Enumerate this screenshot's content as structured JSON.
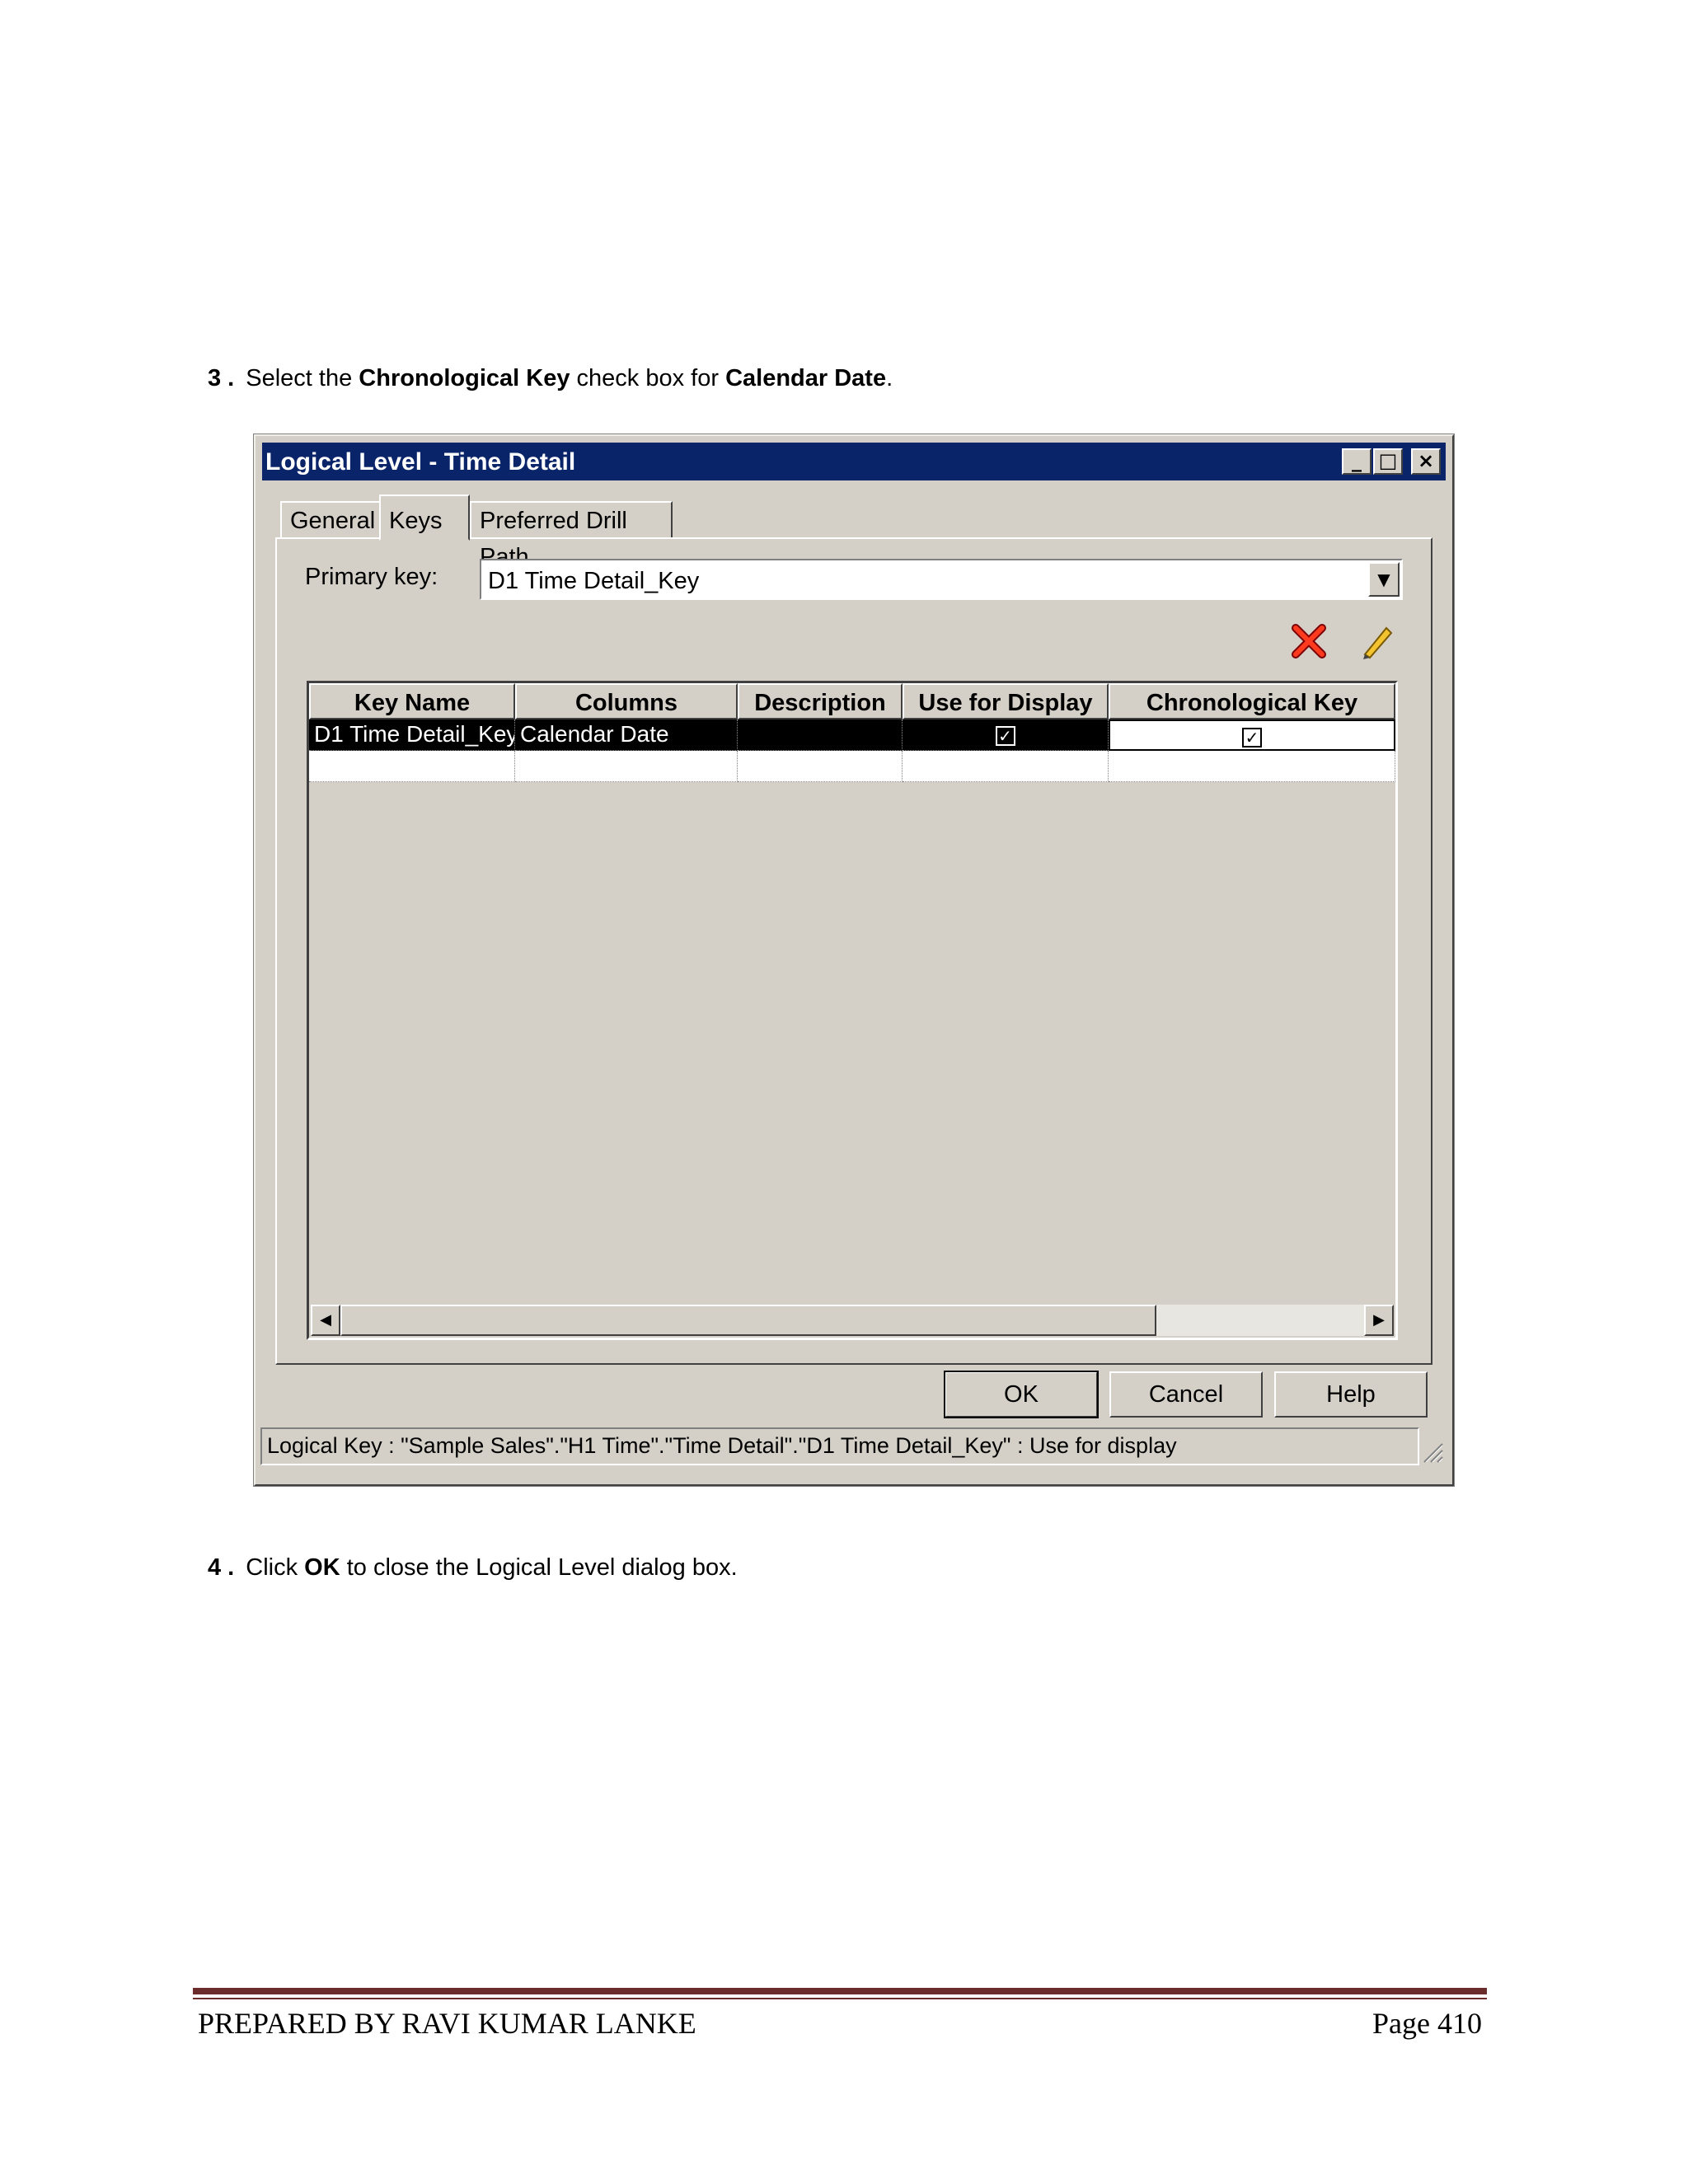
{
  "instructions": {
    "step3": {
      "number": "3 .",
      "pre": "Select the ",
      "b1": "Chronological Key",
      "mid": " check box for ",
      "b2": "Calendar Date",
      "post": "."
    },
    "step4": {
      "number": "4 .",
      "pre": "Click ",
      "b1": "OK",
      "post": " to close the Logical Level dialog box."
    }
  },
  "dialog": {
    "title": "Logical Level - Time Detail",
    "tabs": [
      {
        "label": "General",
        "active": false
      },
      {
        "label": "Keys",
        "active": true
      },
      {
        "label": "Preferred Drill Path",
        "active": false
      }
    ],
    "primary_key_label": "Primary key:",
    "primary_key_value": "D1 Time Detail_Key",
    "toolbar_icons": [
      "delete-icon",
      "edit-icon"
    ],
    "grid": {
      "columns": [
        "Key Name",
        "Columns",
        "Description",
        "Use for Display",
        "Chronological Key"
      ],
      "rows": [
        {
          "key_name": "D1 Time Detail_Key",
          "columns": "Calendar Date",
          "description": "",
          "use_for_display": true,
          "chronological_key": true
        }
      ]
    },
    "buttons": {
      "ok": "OK",
      "cancel": "Cancel",
      "help": "Help"
    },
    "status": "Logical Key : \"Sample Sales\".\"H1 Time\".\"Time Detail\".\"D1 Time Detail_Key\" : Use for display",
    "check_glyph": "✓"
  },
  "footer": {
    "left": "PREPARED BY RAVI KUMAR LANKE",
    "right": "Page 410"
  },
  "colors": {
    "titlebar": "#0a246a",
    "window_face": "#d4d0c8",
    "footer_rule": "#6b2c2c"
  }
}
